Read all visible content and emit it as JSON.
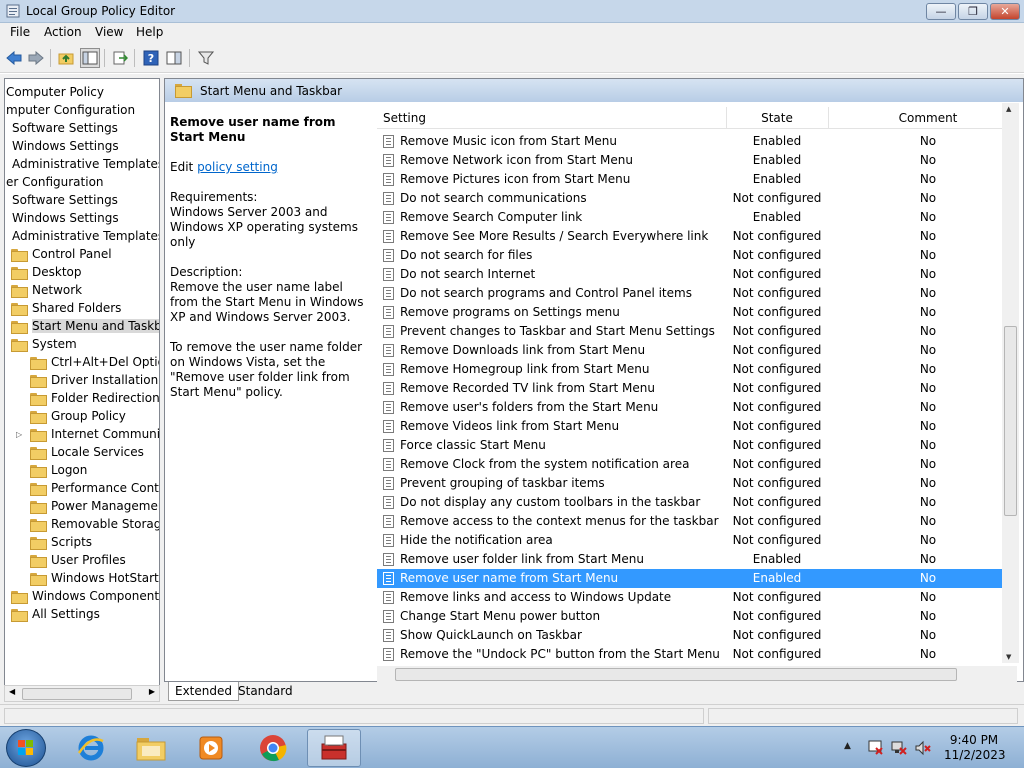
{
  "window": {
    "title": "Local Group Policy Editor"
  },
  "menu": [
    "File",
    "Action",
    "View",
    "Help"
  ],
  "tree": {
    "items": [
      {
        "label": "Computer Policy",
        "indent": 0,
        "folder": false
      },
      {
        "label": "mputer Configuration",
        "indent": 0,
        "folder": false
      },
      {
        "label": "Software Settings",
        "indent": 1,
        "folder": false
      },
      {
        "label": "Windows Settings",
        "indent": 1,
        "folder": false
      },
      {
        "label": "Administrative Templates",
        "indent": 1,
        "folder": false
      },
      {
        "label": "er Configuration",
        "indent": 0,
        "folder": false
      },
      {
        "label": "Software Settings",
        "indent": 1,
        "folder": false
      },
      {
        "label": "Windows Settings",
        "indent": 1,
        "folder": false
      },
      {
        "label": "Administrative Templates",
        "indent": 1,
        "folder": false
      },
      {
        "label": "Control Panel",
        "indent": 2,
        "folder": true
      },
      {
        "label": "Desktop",
        "indent": 2,
        "folder": true
      },
      {
        "label": "Network",
        "indent": 2,
        "folder": true
      },
      {
        "label": "Shared Folders",
        "indent": 2,
        "folder": true
      },
      {
        "label": "Start Menu and Taskbar",
        "indent": 2,
        "folder": true,
        "selected": true
      },
      {
        "label": "System",
        "indent": 2,
        "folder": true
      },
      {
        "label": "Ctrl+Alt+Del Options",
        "indent": 3,
        "folder": true
      },
      {
        "label": "Driver Installation",
        "indent": 3,
        "folder": true
      },
      {
        "label": "Folder Redirection",
        "indent": 3,
        "folder": true
      },
      {
        "label": "Group Policy",
        "indent": 3,
        "folder": true
      },
      {
        "label": "Internet Communication",
        "indent": 3,
        "folder": true,
        "expandable": true
      },
      {
        "label": "Locale Services",
        "indent": 3,
        "folder": true
      },
      {
        "label": "Logon",
        "indent": 3,
        "folder": true
      },
      {
        "label": "Performance Control",
        "indent": 3,
        "folder": true
      },
      {
        "label": "Power Management",
        "indent": 3,
        "folder": true
      },
      {
        "label": "Removable Storage Access",
        "indent": 3,
        "folder": true
      },
      {
        "label": "Scripts",
        "indent": 3,
        "folder": true
      },
      {
        "label": "User Profiles",
        "indent": 3,
        "folder": true
      },
      {
        "label": "Windows HotStart",
        "indent": 3,
        "folder": true
      },
      {
        "label": "Windows Components",
        "indent": 2,
        "folder": true
      },
      {
        "label": "All Settings",
        "indent": 2,
        "folder": true
      }
    ]
  },
  "header": {
    "title": "Start Menu and Taskbar"
  },
  "description": {
    "title": "Remove user name from Start Menu",
    "edit_prefix": "Edit ",
    "edit_link": "policy setting",
    "requirements_label": "Requirements:",
    "requirements": "Windows Server 2003 and Windows XP operating systems only",
    "description_label": "Description:",
    "description": "Remove the user name label from the Start Menu in Windows XP and Windows Server 2003.",
    "note": "To remove the user name folder on Windows Vista, set the \"Remove user folder link from Start Menu\" policy."
  },
  "list": {
    "columns": {
      "setting": "Setting",
      "state": "State",
      "comment": "Comment"
    },
    "rows": [
      {
        "name": "Remove Music icon from Start Menu",
        "state": "Enabled",
        "comment": "No"
      },
      {
        "name": "Remove Network icon from Start Menu",
        "state": "Enabled",
        "comment": "No"
      },
      {
        "name": "Remove Pictures icon from Start Menu",
        "state": "Enabled",
        "comment": "No"
      },
      {
        "name": "Do not search communications",
        "state": "Not configured",
        "comment": "No"
      },
      {
        "name": "Remove Search Computer link",
        "state": "Enabled",
        "comment": "No"
      },
      {
        "name": "Remove See More Results / Search Everywhere link",
        "state": "Not configured",
        "comment": "No"
      },
      {
        "name": "Do not search for files",
        "state": "Not configured",
        "comment": "No"
      },
      {
        "name": "Do not search Internet",
        "state": "Not configured",
        "comment": "No"
      },
      {
        "name": "Do not search programs and Control Panel items",
        "state": "Not configured",
        "comment": "No"
      },
      {
        "name": "Remove programs on Settings menu",
        "state": "Not configured",
        "comment": "No"
      },
      {
        "name": "Prevent changes to Taskbar and Start Menu Settings",
        "state": "Not configured",
        "comment": "No"
      },
      {
        "name": "Remove Downloads link from Start Menu",
        "state": "Not configured",
        "comment": "No"
      },
      {
        "name": "Remove Homegroup link from Start Menu",
        "state": "Not configured",
        "comment": "No"
      },
      {
        "name": "Remove Recorded TV link from Start Menu",
        "state": "Not configured",
        "comment": "No"
      },
      {
        "name": "Remove user's folders from the Start Menu",
        "state": "Not configured",
        "comment": "No"
      },
      {
        "name": "Remove Videos link from Start Menu",
        "state": "Not configured",
        "comment": "No"
      },
      {
        "name": "Force classic Start Menu",
        "state": "Not configured",
        "comment": "No"
      },
      {
        "name": "Remove Clock from the system notification area",
        "state": "Not configured",
        "comment": "No"
      },
      {
        "name": "Prevent grouping of taskbar items",
        "state": "Not configured",
        "comment": "No"
      },
      {
        "name": "Do not display any custom toolbars in the taskbar",
        "state": "Not configured",
        "comment": "No"
      },
      {
        "name": "Remove access to the context menus for the taskbar",
        "state": "Not configured",
        "comment": "No"
      },
      {
        "name": "Hide the notification area",
        "state": "Not configured",
        "comment": "No"
      },
      {
        "name": "Remove user folder link from Start Menu",
        "state": "Enabled",
        "comment": "No"
      },
      {
        "name": "Remove user name from Start Menu",
        "state": "Enabled",
        "comment": "No",
        "selected": true
      },
      {
        "name": "Remove links and access to Windows Update",
        "state": "Not configured",
        "comment": "No"
      },
      {
        "name": "Change Start Menu power button",
        "state": "Not configured",
        "comment": "No"
      },
      {
        "name": "Show QuickLaunch on Taskbar",
        "state": "Not configured",
        "comment": "No"
      },
      {
        "name": "Remove the \"Undock PC\" button from the Start Menu",
        "state": "Not configured",
        "comment": "No"
      }
    ]
  },
  "tabs": [
    "Extended",
    "Standard"
  ],
  "clock": {
    "time": "9:40 PM",
    "date": "11/2/2023"
  },
  "colors": {
    "selection": "#3399ff",
    "link": "#0066cc"
  }
}
